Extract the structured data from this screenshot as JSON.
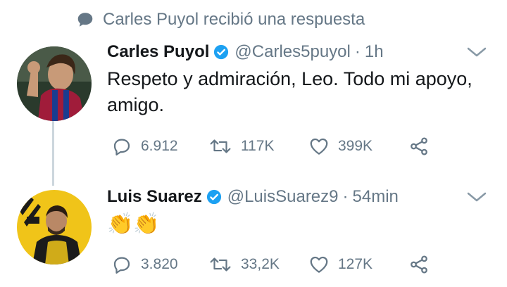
{
  "context": {
    "text": "Carles Puyol recibió una respuesta",
    "icon": "speech-bubble-icon"
  },
  "tweets": [
    {
      "name": "Carles Puyol",
      "handle": "@Carles5puyol",
      "separator": "·",
      "time": "1h",
      "text": "Respeto y admiración, Leo. Todo mi apoyo, amigo.",
      "replies": "6.912",
      "retweets": "117K",
      "likes": "399K"
    },
    {
      "name": "Luis Suarez",
      "handle": "@LuisSuarez9",
      "separator": "·",
      "time": "54min",
      "text": "👏👏",
      "replies": "3.820",
      "retweets": "33,2K",
      "likes": "127K"
    }
  ],
  "colors": {
    "verified": "#1da1f2",
    "muted": "#657786",
    "text": "#14171a",
    "thread_line": "#ccd6dd"
  }
}
